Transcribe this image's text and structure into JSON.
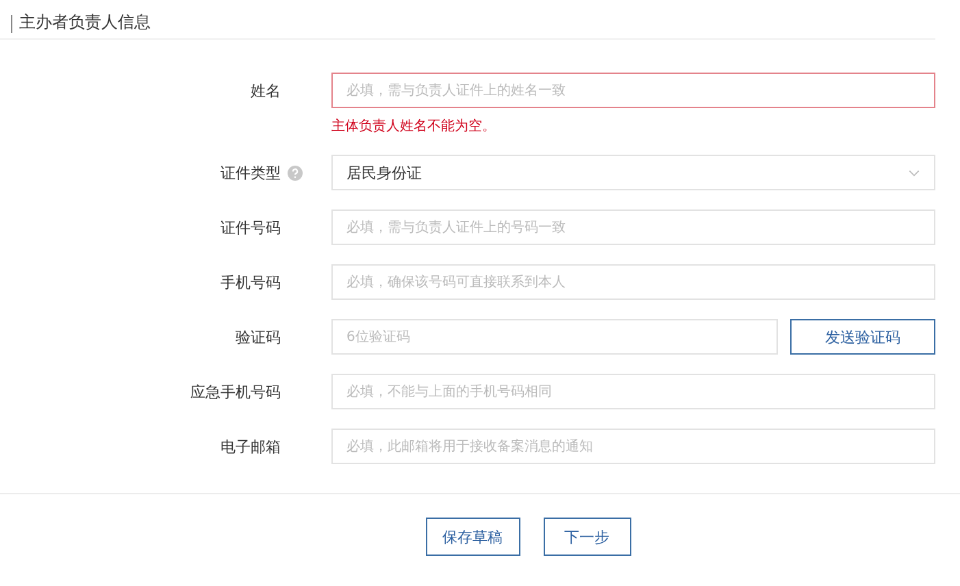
{
  "section": {
    "title": "主办者负责人信息"
  },
  "fields": [
    {
      "kind": "input",
      "label": "姓名",
      "placeholder": "必填，需与负责人证件上的姓名一致",
      "invalid": true,
      "error": "主体负责人姓名不能为空。"
    },
    {
      "kind": "select",
      "label": "证件类型",
      "help": true,
      "value": "居民身份证"
    },
    {
      "kind": "input",
      "label": "证件号码",
      "placeholder": "必填，需与负责人证件上的号码一致",
      "invalid": false
    },
    {
      "kind": "input",
      "label": "手机号码",
      "placeholder": "必填，确保该号码可直接联系到本人",
      "invalid": false
    },
    {
      "kind": "code",
      "label": "验证码",
      "placeholder": "6位验证码",
      "invalid": false,
      "button": "发送验证码"
    },
    {
      "kind": "input",
      "label": "应急手机号码",
      "placeholder": "必填，不能与上面的手机号码相同",
      "invalid": false
    },
    {
      "kind": "input",
      "label": "电子邮箱",
      "placeholder": "必填，此邮箱将用于接收备案消息的通知",
      "invalid": false
    }
  ],
  "actions": [
    "保存草稿",
    "下一步"
  ]
}
